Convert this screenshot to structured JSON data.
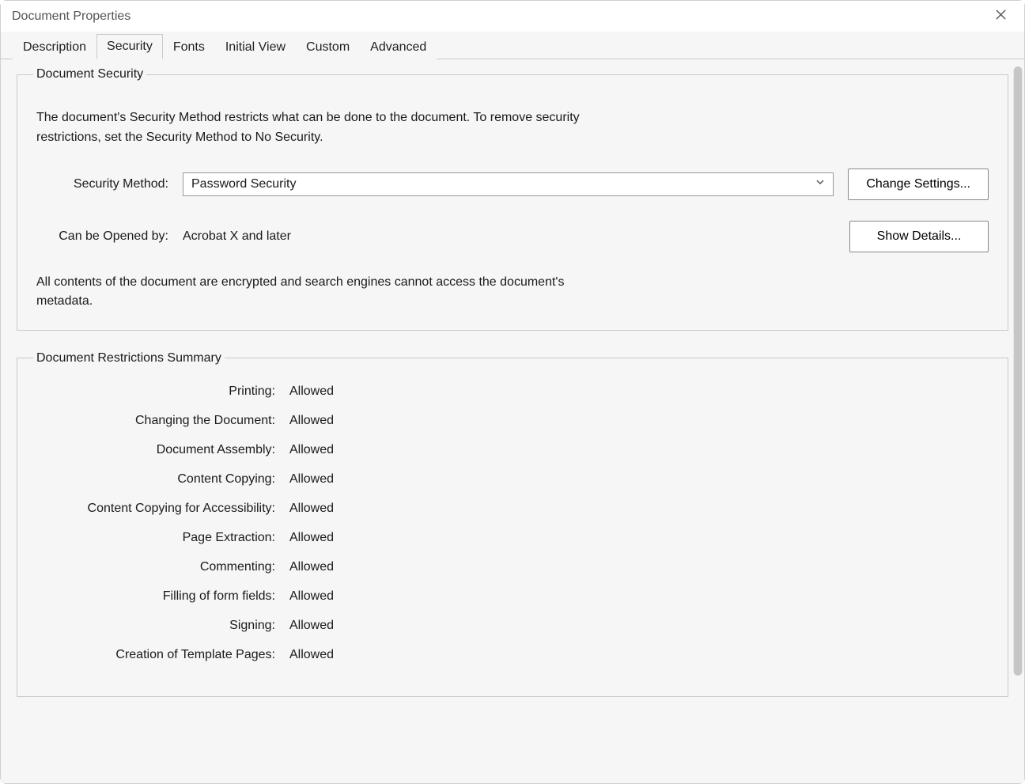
{
  "window": {
    "title": "Document Properties"
  },
  "tabs": {
    "description": "Description",
    "security": "Security",
    "fonts": "Fonts",
    "initial_view": "Initial View",
    "custom": "Custom",
    "advanced": "Advanced"
  },
  "security_group": {
    "legend": "Document Security",
    "description": "The document's Security Method restricts what can be done to the document. To remove security restrictions, set the Security Method to No Security.",
    "method_label": "Security Method:",
    "method_value": "Password Security",
    "change_settings_btn": "Change Settings...",
    "opened_by_label": "Can be Opened by:",
    "opened_by_value": "Acrobat X and later",
    "show_details_btn": "Show Details...",
    "encrypt_note": "All contents of the document are encrypted and search engines cannot access the document's metadata."
  },
  "restrictions_group": {
    "legend": "Document Restrictions Summary",
    "items": [
      {
        "label": "Printing:",
        "value": "Allowed"
      },
      {
        "label": "Changing the Document:",
        "value": "Allowed"
      },
      {
        "label": "Document Assembly:",
        "value": "Allowed"
      },
      {
        "label": "Content Copying:",
        "value": "Allowed"
      },
      {
        "label": "Content Copying for Accessibility:",
        "value": "Allowed"
      },
      {
        "label": "Page Extraction:",
        "value": "Allowed"
      },
      {
        "label": "Commenting:",
        "value": "Allowed"
      },
      {
        "label": "Filling of form fields:",
        "value": "Allowed"
      },
      {
        "label": "Signing:",
        "value": "Allowed"
      },
      {
        "label": "Creation of Template Pages:",
        "value": "Allowed"
      }
    ]
  }
}
